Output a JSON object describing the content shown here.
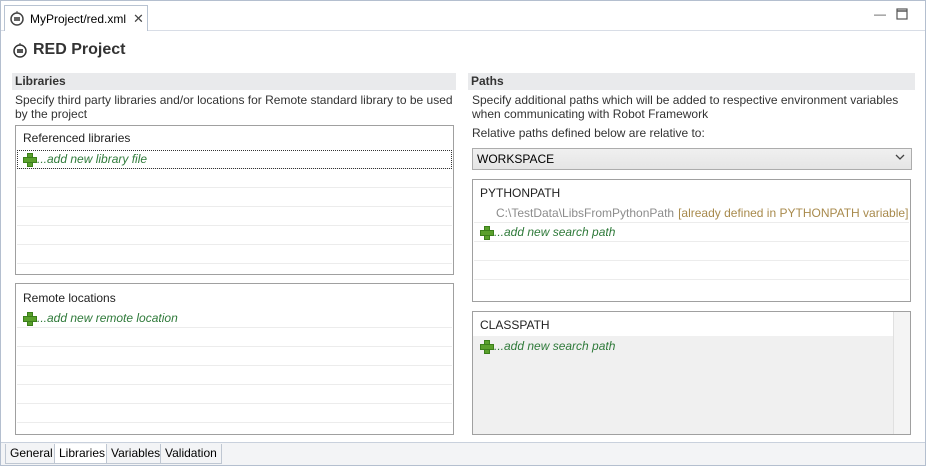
{
  "editor_tab": {
    "label": "MyProject/red.xml"
  },
  "header": {
    "title": "RED Project"
  },
  "libraries": {
    "section_title": "Libraries",
    "description": "Specify third party libraries and/or locations for Remote standard library to be used by the project",
    "referenced": {
      "title": "Referenced libraries",
      "add_label": "...add new library file"
    },
    "remote": {
      "title": "Remote locations",
      "add_label": "...add new remote location"
    }
  },
  "paths": {
    "section_title": "Paths",
    "description": "Specify additional paths which will be added to respective environment variables when communicating with Robot Framework",
    "relative_label": "Relative paths defined below are relative to:",
    "relative_value": "WORKSPACE",
    "pythonpath": {
      "title": "PYTHONPATH",
      "entry_path": "C:\\TestData\\LibsFromPythonPath",
      "entry_note": "[already defined in PYTHONPATH variable]",
      "add_label": "...add new search path"
    },
    "classpath": {
      "title": "CLASSPATH",
      "add_label": "...add new search path"
    }
  },
  "bottom_tabs": [
    {
      "label": "General"
    },
    {
      "label": "Libraries"
    },
    {
      "label": "Variables"
    },
    {
      "label": "Validation"
    }
  ]
}
